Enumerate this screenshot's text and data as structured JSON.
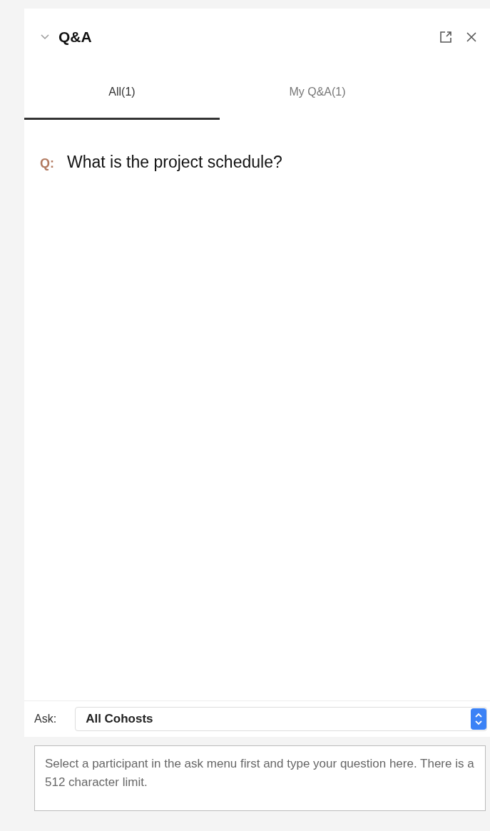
{
  "panel": {
    "title": "Q&A",
    "expanded": true
  },
  "tabs": [
    {
      "label": "All(1)",
      "selected": true
    },
    {
      "label": "My Q&A(1)",
      "selected": false
    }
  ],
  "questions": [
    {
      "marker": "Q:",
      "text": "What is the project schedule?"
    }
  ],
  "ask": {
    "label": "Ask:",
    "value": "All Cohosts"
  },
  "question_field": {
    "placeholder": "Select a participant in the ask menu first and type your question here. There is a 512 character limit."
  }
}
